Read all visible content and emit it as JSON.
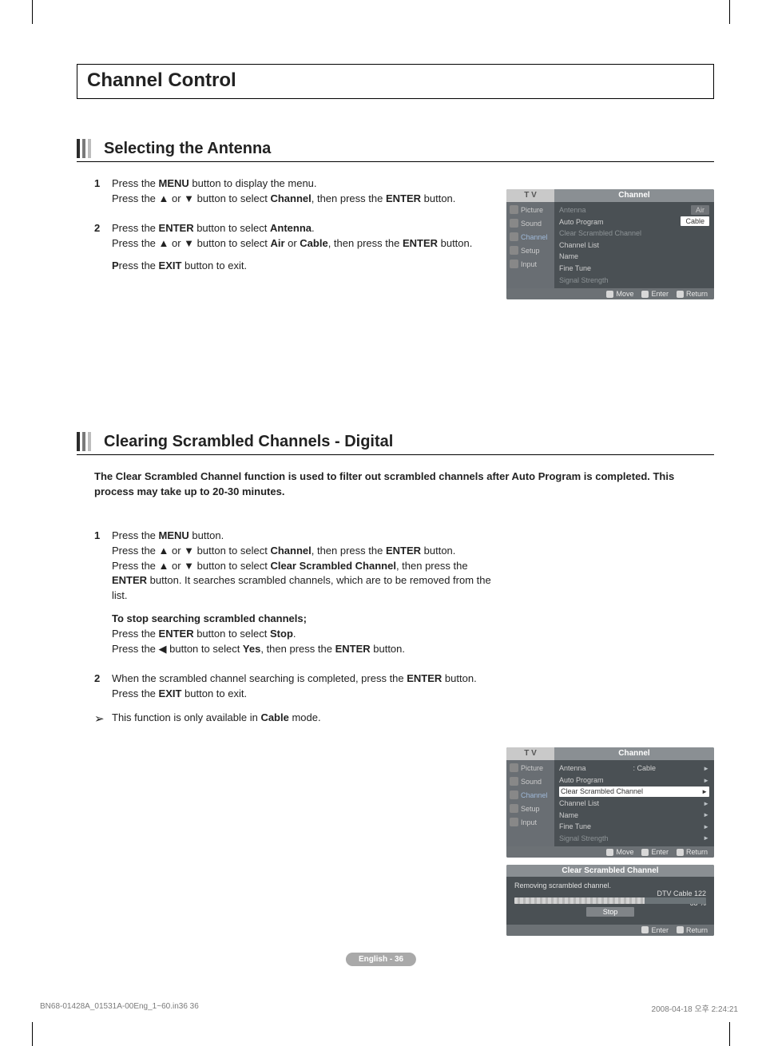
{
  "page_title": "Channel Control",
  "section1": {
    "title": "Selecting the Antenna",
    "steps": [
      {
        "num": "1",
        "lines": [
          "Press the <b>MENU</b> button to display the menu.",
          "Press the ▲ or ▼ button to select <b>Channel</b>, then press the <b>ENTER</b> button."
        ]
      },
      {
        "num": "2",
        "lines": [
          "Press the <b>ENTER</b> button to select <b>Antenna</b>.",
          "Press the ▲ or ▼ button to select <b>Air</b> or <b>Cable</b>, then press the <b>ENTER</b> button.",
          "<b>P</b>ress the <b>EXIT</b> button to exit."
        ]
      }
    ]
  },
  "section2": {
    "title": "Clearing Scrambled Channels - Digital",
    "intro": "The Clear Scrambled Channel function is used to filter out scrambled channels after Auto Program is completed. This process may take up to 20-30 minutes.",
    "steps": [
      {
        "num": "1",
        "lines": [
          "Press the <b>MENU</b> button.",
          "Press the ▲ or ▼ button to select <b>Channel</b>, then press the <b>ENTER</b> button.",
          "Press the ▲ or ▼ button to select <b>Clear Scrambled Channel</b>, then press the <b>ENTER</b> button. It searches scrambled channels, which are to be removed from the list.",
          "<b>To stop searching scrambled channels;</b>",
          "Press the <b>ENTER</b> button to select <b>Stop</b>.",
          "Press the ◀ button to select <b>Yes</b>, then press the <b>ENTER</b> button."
        ]
      },
      {
        "num": "2",
        "lines": [
          "When the scrambled channel searching is completed, press the <b>ENTER</b> button.",
          "Press the <b>EXIT</b> button to exit."
        ]
      }
    ],
    "note": "This function is only available in <b>Cable</b> mode."
  },
  "osd": {
    "header_left": "T V",
    "header_right": "Channel",
    "side_items": [
      "Picture",
      "Sound",
      "Channel",
      "Setup",
      "Input"
    ],
    "menu1": {
      "antenna_label": "Antenna",
      "air": "Air",
      "cable": "Cable",
      "items": [
        "Auto Program",
        "Clear Scrambled Channel",
        "Channel List",
        "Name",
        "Fine Tune",
        "Signal Strength"
      ]
    },
    "menu2": {
      "antenna_label": "Antenna",
      "antenna_value": ": Cable",
      "items": [
        "Auto Program",
        "Clear Scrambled Channel",
        "Channel List",
        "Name",
        "Fine Tune",
        "Signal Strength"
      ]
    },
    "footer": {
      "move": "Move",
      "enter": "Enter",
      "return": "Return"
    }
  },
  "osd3": {
    "title": "Clear Scrambled Channel",
    "status": "Removing scrambled channel.",
    "info1": "DTV Cable 122",
    "info2": "68 %",
    "stop": "Stop",
    "footer": {
      "enter": "Enter",
      "return": "Return"
    }
  },
  "page_badge": "English - 36",
  "footer": {
    "left": "BN68-01428A_01531A-00Eng_1~60.in36   36",
    "right": "2008-04-18   오후 2:24:21"
  }
}
